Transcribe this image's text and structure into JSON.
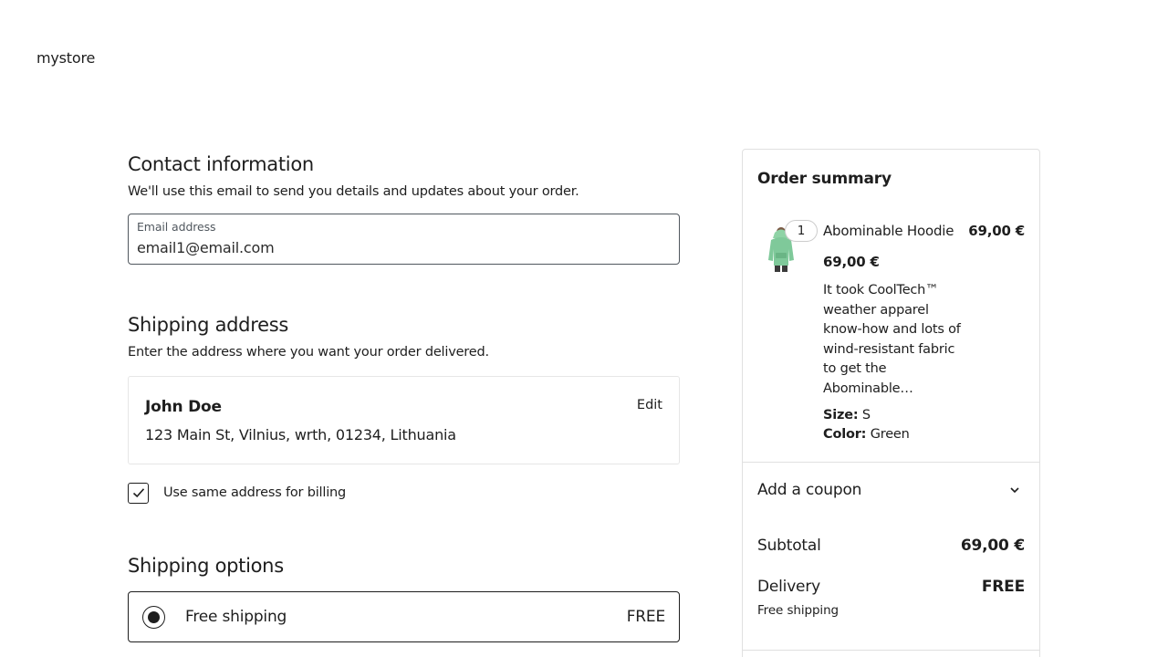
{
  "header": {
    "brand": "mystore"
  },
  "contact": {
    "title": "Contact information",
    "description": "We'll use this email to send you details and updates about your order.",
    "email_label": "Email address",
    "email_value": "email1@email.com"
  },
  "shipping_address": {
    "title": "Shipping address",
    "description": "Enter the address where you want your order delivered.",
    "name": "John Doe",
    "address": "123 Main St, Vilnius, wrth, 01234, Lithuania",
    "edit_label": "Edit",
    "billing_same_label": "Use same address for billing",
    "billing_same_checked": true
  },
  "shipping_options": {
    "title": "Shipping options",
    "options": [
      {
        "label": "Free shipping",
        "price": "FREE",
        "selected": true
      }
    ]
  },
  "order_summary": {
    "title": "Order summary",
    "item": {
      "quantity": "1",
      "name": "Abominable Hoodie",
      "line_total": "69,00 €",
      "unit_price": "69,00 €",
      "description": "It took CoolTech™ weather apparel know-how and lots of wind-resistant fabric to get the Abominable…",
      "size_label": "Size:",
      "size_value": "S",
      "color_label": "Color:",
      "color_value": "Green",
      "image_color": "#7fc99a"
    },
    "coupon_label": "Add a coupon",
    "subtotal_label": "Subtotal",
    "subtotal_value": "69,00 €",
    "delivery_label": "Delivery",
    "delivery_value": "FREE",
    "delivery_method": "Free shipping"
  }
}
